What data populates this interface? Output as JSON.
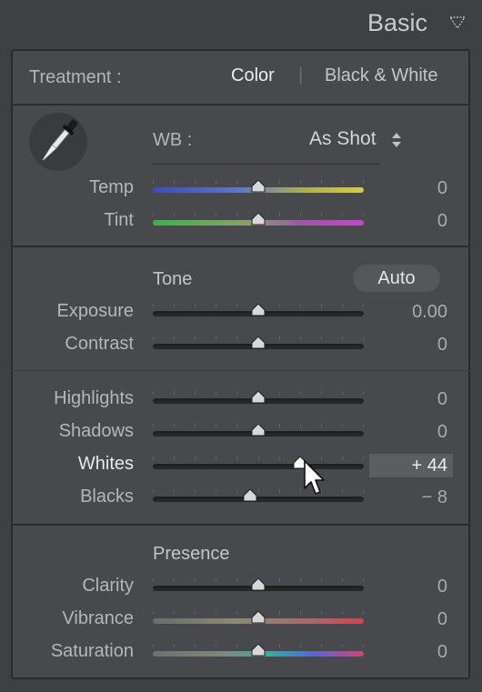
{
  "panel": {
    "title": "Basic",
    "collapse_icon": "triangle-down-icon"
  },
  "treatment": {
    "label": "Treatment :",
    "color": "Color",
    "bw": "Black & White",
    "divider": "|"
  },
  "wb": {
    "label": "WB :",
    "value": "As Shot",
    "stepper_icon": "updown-icon",
    "eyedropper_icon": "eyedropper-icon"
  },
  "sliders_wb": [
    {
      "id": "temp",
      "label": "Temp",
      "value": "0",
      "position": 0.5,
      "track": "temp"
    },
    {
      "id": "tint",
      "label": "Tint",
      "value": "0",
      "position": 0.5,
      "track": "tint"
    }
  ],
  "tone": {
    "title": "Tone",
    "auto": "Auto"
  },
  "sliders_tone": [
    {
      "id": "exposure",
      "label": "Exposure",
      "value": "0.00",
      "position": 0.5,
      "track": "plain"
    },
    {
      "id": "contrast",
      "label": "Contrast",
      "value": "0",
      "position": 0.5,
      "track": "plain"
    }
  ],
  "sliders_tone2": [
    {
      "id": "highlights",
      "label": "Highlights",
      "value": "0",
      "position": 0.5,
      "track": "plain"
    },
    {
      "id": "shadows",
      "label": "Shadows",
      "value": "0",
      "position": 0.5,
      "track": "plain"
    },
    {
      "id": "whites",
      "label": "Whites",
      "value": "+ 44",
      "position": 0.7,
      "track": "plain",
      "active": true
    },
    {
      "id": "blacks",
      "label": "Blacks",
      "value": "− 8",
      "position": 0.46,
      "track": "plain"
    }
  ],
  "presence": {
    "title": "Presence"
  },
  "sliders_presence": [
    {
      "id": "clarity",
      "label": "Clarity",
      "value": "0",
      "position": 0.5,
      "track": "plain"
    },
    {
      "id": "vibrance",
      "label": "Vibrance",
      "value": "0",
      "position": 0.5,
      "track": "vibrance"
    },
    {
      "id": "saturation",
      "label": "Saturation",
      "value": "0",
      "position": 0.5,
      "track": "saturation"
    }
  ],
  "cursor_icon": "arrow-cursor-icon"
}
